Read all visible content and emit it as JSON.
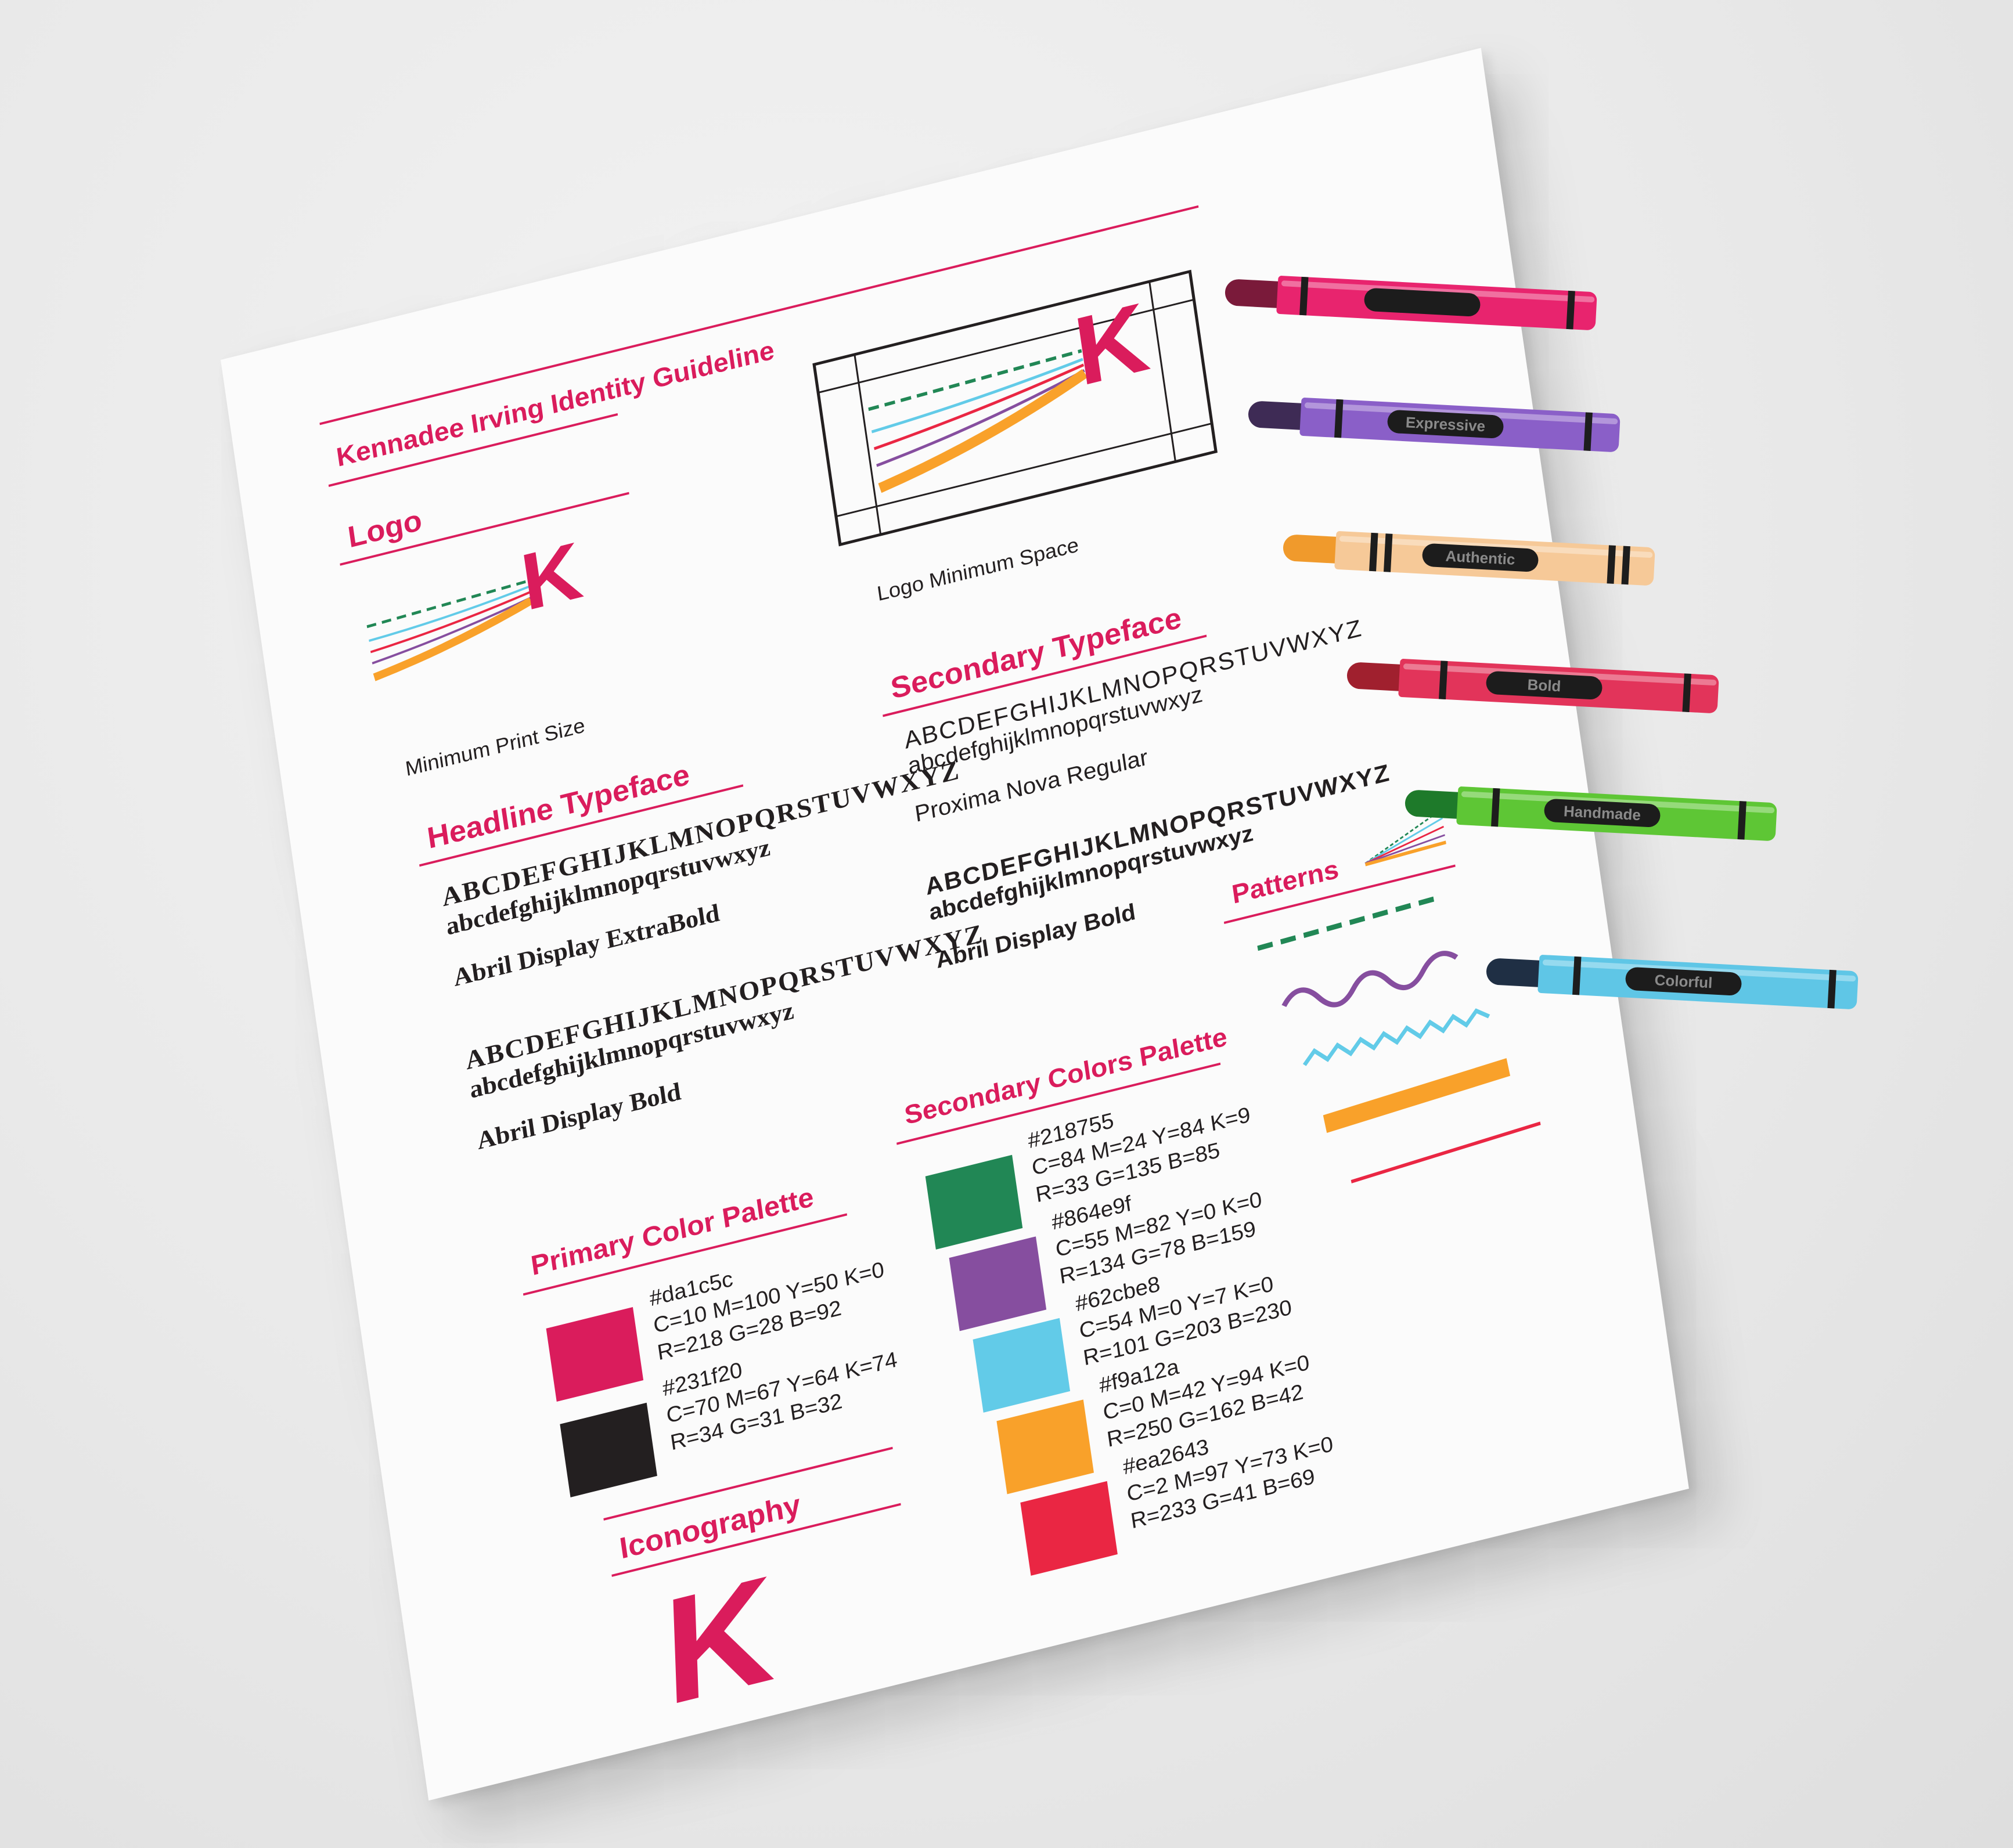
{
  "document": {
    "title": "Kennadee Irving Identity Guideline",
    "logo_heading": "Logo",
    "logo_min_print": "Minimum Print Size",
    "logo_min_space": "Logo Minimum Space",
    "headline_typeface_heading": "Headline Typeface",
    "headline_fonts": [
      {
        "upper": "ABCDEFGHIJKLMNOPQRSTUVWXYZ",
        "lower": "abcdefghijklmnopqrstuvwxyz",
        "name": "Abril Display ExtraBold"
      },
      {
        "upper": "ABCDEFGHIJKLMNOPQRSTUVWXYZ",
        "lower": "abcdefghijklmnopqrstuvwxyz",
        "name": "Abril Display Bold"
      }
    ],
    "secondary_typeface_heading": "Secondary Typeface",
    "secondary_fonts": [
      {
        "upper": "ABCDEFGHIJKLMNOPQRSTUVWXYZ",
        "lower": "abcdefghijklmnopqrstuvwxyz",
        "name": "Proxima Nova Regular"
      },
      {
        "upper": "ABCDEFGHIJKLMNOPQRSTUVWXYZ",
        "lower": "abcdefghijklmnopqrstuvwxyz",
        "name": "Abril Display Bold"
      }
    ],
    "patterns_heading": "Patterns",
    "primary_palette_heading": "Primary Color Palette",
    "primary_colors": [
      {
        "hex": "#da1c5c",
        "cmyk": "C=10 M=100 Y=50 K=0",
        "rgb": "R=218 G=28 B=92",
        "swatch": "#da1c5c"
      },
      {
        "hex": "#231f20",
        "cmyk": "C=70 M=67 Y=64 K=74",
        "rgb": "R=34 G=31 B=32",
        "swatch": "#231f20"
      }
    ],
    "secondary_palette_heading": "Secondary Colors Palette",
    "secondary_colors": [
      {
        "hex": "#218755",
        "cmyk": "C=84 M=24 Y=84 K=9",
        "rgb": "R=33 G=135 B=85",
        "swatch": "#218755"
      },
      {
        "hex": "#864e9f",
        "cmyk": "C=55 M=82 Y=0 K=0",
        "rgb": "R=134 G=78 B=159",
        "swatch": "#864e9f"
      },
      {
        "hex": "#62cbe8",
        "cmyk": "C=54 M=0 Y=7 K=0",
        "rgb": "R=101 G=203 B=230",
        "swatch": "#62cbe8"
      },
      {
        "hex": "#f9a12a",
        "cmyk": "C=0 M=42 Y=94 K=0",
        "rgb": "R=250 G=162 B=42",
        "swatch": "#f9a12a"
      },
      {
        "hex": "#ea2643",
        "cmyk": "C=2 M=97 Y=73 K=0",
        "rgb": "R=233 G=41 B=69",
        "swatch": "#ea2643"
      }
    ],
    "iconography_heading": "Iconography",
    "logo_letter": "K"
  },
  "crayons": [
    {
      "label": "",
      "color": "#e8246e",
      "tip": "#7a1a3a"
    },
    {
      "label": "Expressive",
      "color": "#8a5fc8",
      "tip": "#3e2b55"
    },
    {
      "label": "Authentic",
      "color": "#f6c998",
      "tip": "#f09a2c"
    },
    {
      "label": "Bold",
      "color": "#e2345a",
      "tip": "#a0202e"
    },
    {
      "label": "Handmade",
      "color": "#5ec635",
      "tip": "#1e7a2a"
    },
    {
      "label": "Colorful",
      "color": "#5fc6e6",
      "tip": "#1f2f44"
    }
  ],
  "colors": {
    "accent": "#da1c5c",
    "ink": "#231f20"
  }
}
